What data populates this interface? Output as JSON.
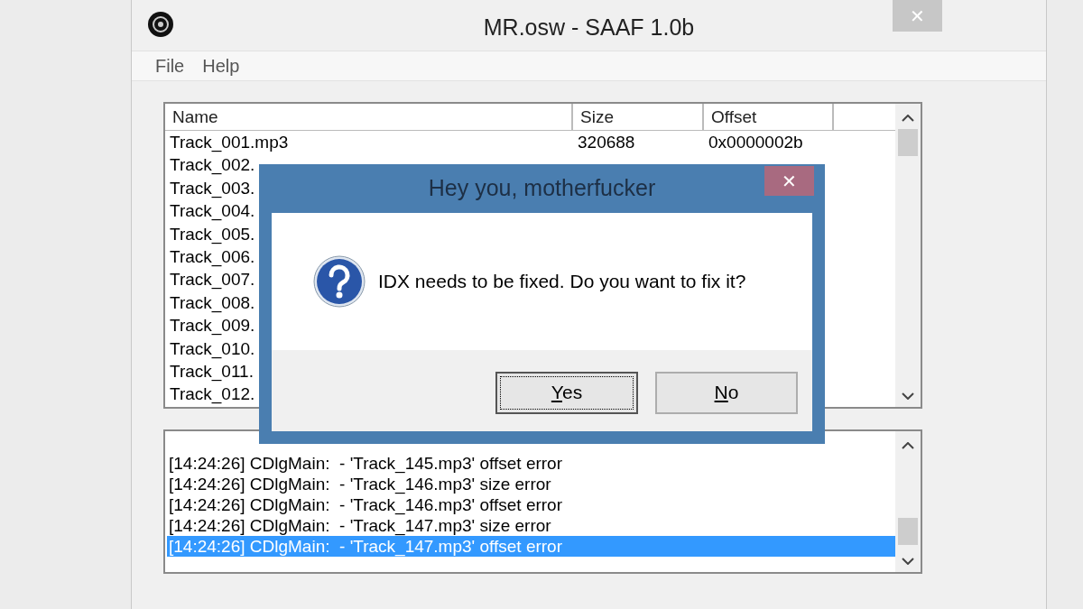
{
  "window": {
    "title": "MR.osw - SAAF 1.0b",
    "close": "✕"
  },
  "menu": [
    {
      "label": "File"
    },
    {
      "label": "Help"
    }
  ],
  "file_list": {
    "columns": [
      "Name",
      "Size",
      "Offset"
    ],
    "rows": [
      {
        "name": "Track_001.mp3",
        "size": "320688",
        "offset": "0x0000002b"
      },
      {
        "name": "Track_002."
      },
      {
        "name": "Track_003."
      },
      {
        "name": "Track_004."
      },
      {
        "name": "Track_005."
      },
      {
        "name": "Track_006."
      },
      {
        "name": "Track_007."
      },
      {
        "name": "Track_008."
      },
      {
        "name": "Track_009."
      },
      {
        "name": "Track_010."
      },
      {
        "name": "Track_011."
      },
      {
        "name": "Track_012."
      }
    ]
  },
  "log": {
    "lines": [
      {
        "text": "[14:24:26] CDlgMain:  - 'Track_145.mp3' offset error",
        "selected": false
      },
      {
        "text": "[14:24:26] CDlgMain:  - 'Track_146.mp3' size error",
        "selected": false
      },
      {
        "text": "[14:24:26] CDlgMain:  - 'Track_146.mp3' offset error",
        "selected": false
      },
      {
        "text": "[14:24:26] CDlgMain:  - 'Track_147.mp3' size error",
        "selected": false
      },
      {
        "text": "[14:24:26] CDlgMain:  - 'Track_147.mp3' offset error",
        "selected": true
      }
    ]
  },
  "dialog": {
    "title": "Hey you, motherfucker",
    "close": "✕",
    "message": "IDX needs to be fixed. Do you want to fix it?",
    "buttons": [
      {
        "label": "Yes",
        "first_letter_underlined": true,
        "focused": true
      },
      {
        "label": "No",
        "first_letter_underlined": true,
        "focused": false
      }
    ]
  }
}
